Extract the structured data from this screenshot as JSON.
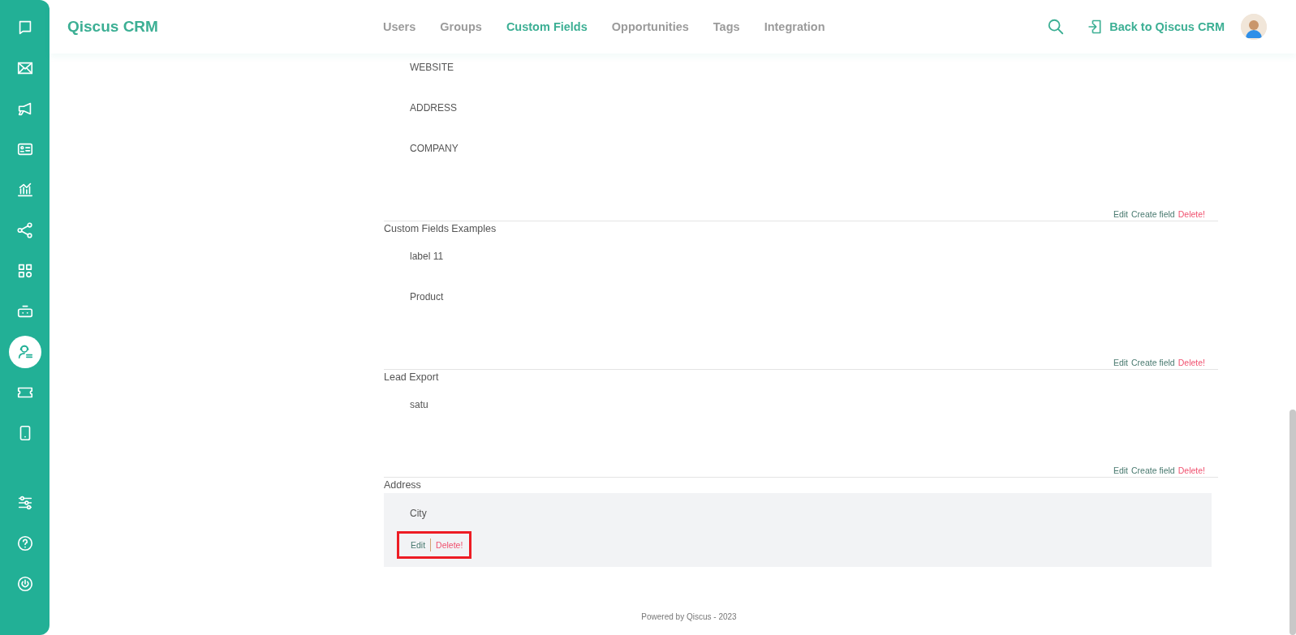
{
  "sidebar": {
    "items": [
      {
        "selected": false
      },
      {
        "selected": false
      },
      {
        "selected": false
      },
      {
        "selected": false
      },
      {
        "selected": false
      },
      {
        "selected": false
      },
      {
        "selected": false
      },
      {
        "selected": false
      },
      {
        "selected": true
      },
      {
        "selected": false
      },
      {
        "selected": false
      }
    ],
    "bottom_items": [
      {
        "selected": false
      },
      {
        "selected": false
      },
      {
        "selected": false
      }
    ]
  },
  "header": {
    "brand": "Qiscus CRM",
    "tabs": [
      {
        "label": "Users",
        "selected": false
      },
      {
        "label": "Groups",
        "selected": false
      },
      {
        "label": "Custom Fields",
        "selected": true
      },
      {
        "label": "Opportunities",
        "selected": false
      },
      {
        "label": "Tags",
        "selected": false
      },
      {
        "label": "Integration",
        "selected": false
      }
    ],
    "back_link": "Back to Qiscus CRM"
  },
  "groups": [
    {
      "fields": [
        {
          "label": "WEBSITE",
          "selected": false
        },
        {
          "label": "ADDRESS",
          "selected": false
        },
        {
          "label": "COMPANY",
          "selected": false
        }
      ],
      "actions": [
        {
          "label": "Edit",
          "kind": "edit"
        },
        {
          "label": "Create field",
          "kind": "create"
        },
        {
          "label": "Delete!",
          "kind": "delete"
        }
      ]
    },
    {
      "title": "Custom Fields Examples",
      "fields": [
        {
          "label": "label 11",
          "selected": false
        },
        {
          "label": "Product",
          "selected": false
        }
      ],
      "actions": [
        {
          "label": "Edit",
          "kind": "edit"
        },
        {
          "label": "Create field",
          "kind": "create"
        },
        {
          "label": "Delete!",
          "kind": "delete"
        }
      ]
    },
    {
      "title": "Lead Export",
      "fields": [
        {
          "label": "satu",
          "selected": false
        }
      ],
      "actions": [
        {
          "label": "Edit",
          "kind": "edit"
        },
        {
          "label": "Create field",
          "kind": "create"
        },
        {
          "label": "Delete!",
          "kind": "delete"
        }
      ]
    },
    {
      "title": "Address",
      "fields": [
        {
          "label": "City",
          "selected": true,
          "highlighted": true,
          "actions": [
            {
              "label": "Edit",
              "kind": "edit"
            },
            {
              "label": "Delete!",
              "kind": "delete"
            }
          ]
        }
      ]
    }
  ],
  "footer": "Powered by Qiscus - 2023"
}
